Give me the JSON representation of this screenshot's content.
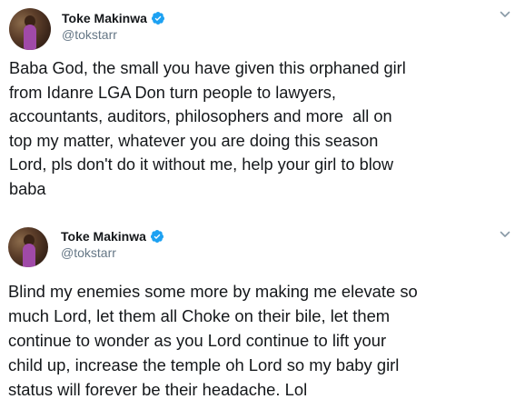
{
  "tweets": [
    {
      "author": {
        "display_name": "Toke Makinwa",
        "handle": "@tokstarr",
        "verified": true
      },
      "text": "Baba God, the small you have given this orphaned girl\nfrom Idanre LGA Don turn people to lawyers,\naccountants, auditors, philosophers and more  all on\ntop my matter, whatever you are doing this season\nLord, pls don't do it without me, help your girl to blow\nbaba"
    },
    {
      "author": {
        "display_name": "Toke Makinwa",
        "handle": "@tokstarr",
        "verified": true
      },
      "text": "Blind my enemies some more by making me elevate so\nmuch Lord, let them all Choke on their bile, let them\ncontinue to wonder as you Lord continue to lift your\nchild up, increase the temple oh Lord so my baby girl\nstatus will forever be their headache. Lol"
    }
  ],
  "colors": {
    "verified_badge": "#1da1f2",
    "handle_text": "#657786",
    "body_text": "#14171a",
    "chevron": "#8899a6"
  },
  "icons": {
    "verified": "verified-badge-icon",
    "menu": "chevron-down-icon"
  }
}
